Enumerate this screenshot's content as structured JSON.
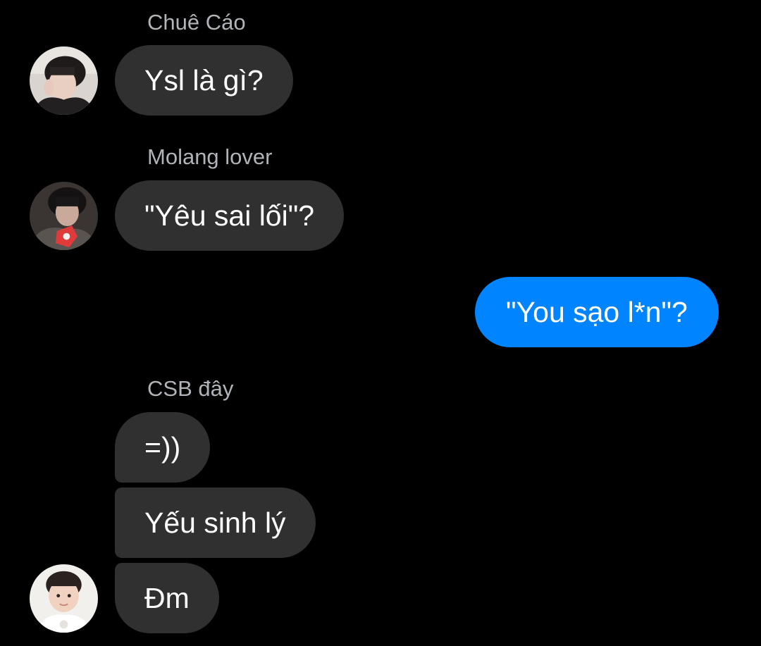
{
  "colors": {
    "background": "#000000",
    "incoming_bubble": "#303030",
    "outgoing_bubble": "#0084ff",
    "sender_name": "#b0b3b8"
  },
  "messages": [
    {
      "sender": "Chuê Cáo",
      "text": "Ysl là gì?",
      "avatar": "avatar-chue-cao"
    },
    {
      "sender": "Molang lover",
      "text": "\"Yêu sai lối\"?",
      "avatar": "avatar-molang-lover"
    },
    {
      "sender": "",
      "text": "\"You sạo l*n\"?",
      "outgoing": true
    },
    {
      "sender": "CSB đây",
      "group": [
        "=))",
        "Yếu sinh lý",
        "Đm"
      ],
      "avatar": "avatar-csb-day"
    }
  ]
}
